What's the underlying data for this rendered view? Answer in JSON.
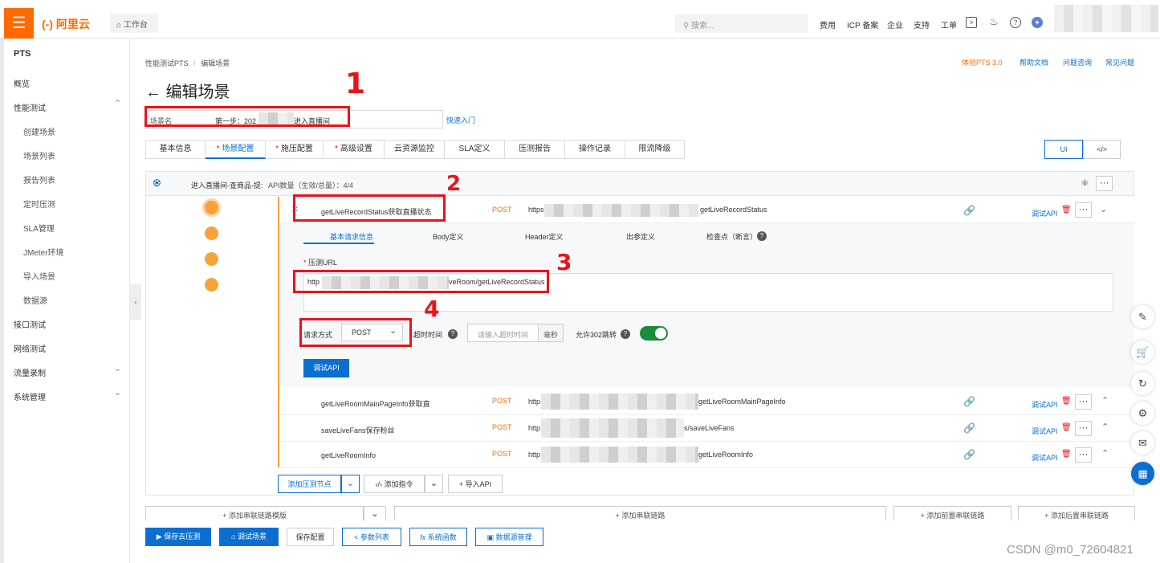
{
  "topbar": {
    "menu_icon": "hamburger-icon",
    "logo": "(-) 阿里云",
    "workbench": "工作台",
    "search_placeholder": "搜索...",
    "nav": [
      "费用",
      "ICP 备案",
      "企业",
      "支持",
      "工单"
    ]
  },
  "sidebar": {
    "product": "PTS",
    "items": [
      {
        "label": "概览"
      },
      {
        "label": "性能测试",
        "expanded": true
      },
      {
        "label": "创建场景",
        "sub": true
      },
      {
        "label": "场景列表",
        "sub": true
      },
      {
        "label": "报告列表",
        "sub": true
      },
      {
        "label": "定时压测",
        "sub": true
      },
      {
        "label": "SLA管理",
        "sub": true
      },
      {
        "label": "JMeter环境",
        "sub": true
      },
      {
        "label": "导入场景",
        "sub": true
      },
      {
        "label": "数据源",
        "sub": true
      },
      {
        "label": "接口测试"
      },
      {
        "label": "网络测试"
      },
      {
        "label": "流量录制",
        "expandable": true
      },
      {
        "label": "系统管理",
        "expandable": true
      }
    ]
  },
  "breadcrumb": {
    "a": "性能测试PTS",
    "sep": "/",
    "b": "编辑场景"
  },
  "top_links": [
    "体验PTS 3.0",
    "帮助文档",
    "问题咨询",
    "常见问题"
  ],
  "page_title": "编辑场景",
  "scene": {
    "label": "场景名",
    "value_prefix": "第一步：202",
    "value_suffix": "进入直播间",
    "quick_start": "快速入门"
  },
  "tabs": [
    {
      "label": "基本信息",
      "star": false
    },
    {
      "label": "场景配置",
      "star": true,
      "active": true
    },
    {
      "label": "施压配置",
      "star": true
    },
    {
      "label": "高级设置",
      "star": true
    },
    {
      "label": "云资源监控",
      "star": false
    },
    {
      "label": "SLA定义",
      "star": false
    },
    {
      "label": "压测报告",
      "star": false
    },
    {
      "label": "操作记录",
      "star": false
    },
    {
      "label": "限流降级",
      "star": false
    }
  ],
  "view_toggle": {
    "ui": "UI",
    "code": "</>"
  },
  "chain": {
    "name": "进入直播间-查商品-提:",
    "api_count": "API数量（生效/总量）：4/4"
  },
  "apis": [
    {
      "name": "getLiveRecordStatus获取直播状态",
      "method": "POST",
      "url_start": "https:",
      "url_end": "getLiveRecordStatus",
      "debug": "调试API",
      "expanded": true
    },
    {
      "name": "getLiveRoomMainPageInfo获取直",
      "method": "POST",
      "url_start": "http",
      "url_end": "getLiveRoomMainPageInfo",
      "debug": "调试API"
    },
    {
      "name": "saveLiveFans保存粉丝",
      "method": "POST",
      "url_start": "http",
      "url_end": "s/saveLiveFans",
      "debug": "调试API"
    },
    {
      "name": "getLiveRoomInfo",
      "method": "POST",
      "url_start": "http",
      "url_end": "getLiveRoomInfo",
      "debug": "调试API"
    }
  ],
  "detail": {
    "subtabs": [
      "基本请求信息",
      "Body定义",
      "Header定义",
      "出参定义",
      "检查点（断言）"
    ],
    "url_label": "压测URL",
    "url_start": "http",
    "url_end": "veRoom/getLiveRecordStatus",
    "method_label": "请求方式",
    "method_value": "POST",
    "timeout_label": "超时时间",
    "timeout_placeholder": "请输入超时时间",
    "timeout_unit": "毫秒",
    "redirect_label": "允许302跳转",
    "redirect_on": true,
    "debug_button": "调试API"
  },
  "add_row": {
    "add_node": "添加压测节点",
    "add_cmd": "添加指令",
    "import_api": "导入API"
  },
  "lower_row": {
    "template": "+ 添加串联链路模版",
    "add_chain": "+ 添加串联链路",
    "add_pre": "+ 添加前置串联链路",
    "add_post": "+ 添加后置串联链路"
  },
  "bottom": {
    "save_run": "保存去压测",
    "debug_scene": "调试场景",
    "save_config": "保存配置",
    "params": "参数列表",
    "sys_func": "系统函数",
    "datasource": "数据源管理"
  },
  "annotations": [
    "1",
    "2",
    "3",
    "4"
  ],
  "watermark": "CSDN @m0_72604821",
  "colors": {
    "accent": "#ff6a00",
    "primary": "#0a6fd0",
    "annotation": "#e8141a",
    "node": "#f7a33a",
    "toggle": "#1e8a3b"
  }
}
